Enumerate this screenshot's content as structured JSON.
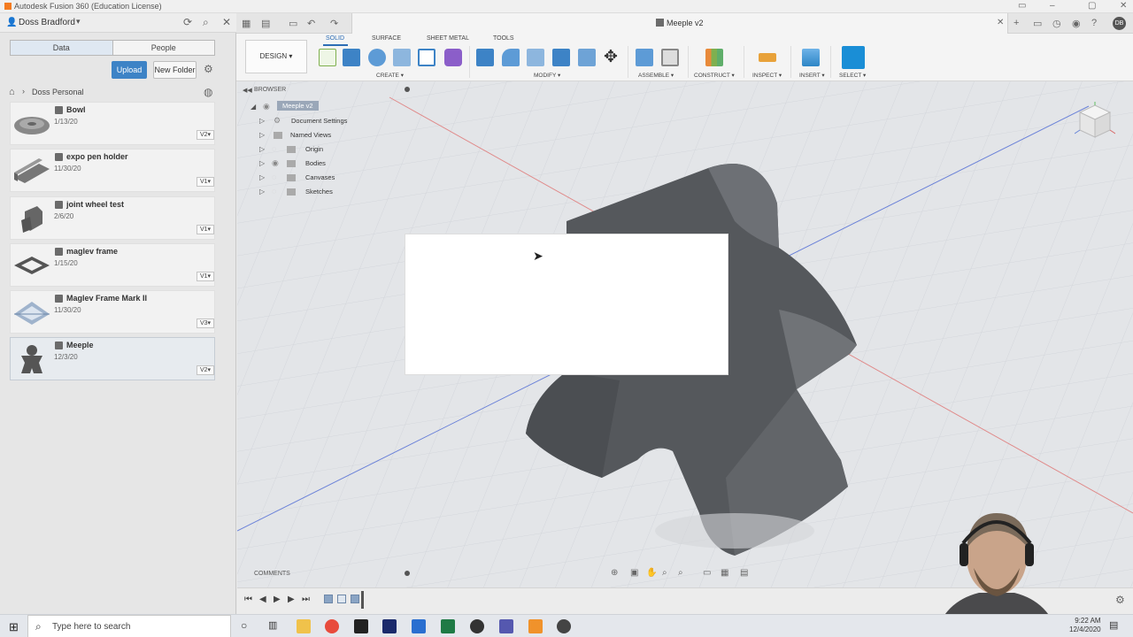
{
  "window": {
    "title": "Autodesk Fusion 360 (Education License)"
  },
  "data_panel": {
    "user_name": "Doss Bradford",
    "tabs": [
      "Data",
      "People"
    ],
    "upload_label": "Upload",
    "new_folder_label": "New Folder",
    "breadcrumb": "Doss Personal",
    "files": [
      {
        "name": "Bowl",
        "date": "1/13/20",
        "version": "V2"
      },
      {
        "name": "expo pen holder",
        "date": "11/30/20",
        "version": "V1"
      },
      {
        "name": "joint wheel test",
        "date": "2/6/20",
        "version": "V1"
      },
      {
        "name": "maglev frame",
        "date": "1/15/20",
        "version": "V1"
      },
      {
        "name": "Maglev Frame Mark II",
        "date": "11/30/20",
        "version": "V3"
      },
      {
        "name": "Meeple",
        "date": "12/3/20",
        "version": "V2"
      }
    ]
  },
  "document_tab": {
    "title": "Meeple v2"
  },
  "toolbar": {
    "workspace": "DESIGN",
    "tabs": [
      "SOLID",
      "SURFACE",
      "SHEET METAL",
      "TOOLS"
    ],
    "groups": [
      "CREATE",
      "MODIFY",
      "ASSEMBLE",
      "CONSTRUCT",
      "INSPECT",
      "INSERT",
      "SELECT"
    ]
  },
  "browser": {
    "header": "BROWSER",
    "root": "Meeple v2",
    "items": [
      "Document Settings",
      "Named Views",
      "Origin",
      "Bodies",
      "Canvases",
      "Sketches"
    ]
  },
  "comments": {
    "label": "COMMENTS"
  },
  "taskbar": {
    "search_placeholder": "Type here to search",
    "time": "9:22 AM",
    "date": "12/4/2020"
  },
  "colors": {
    "accent": "#2d6db5",
    "upload": "#3d83c6",
    "canvas": "#e3e5e8",
    "model": "#5a5d61"
  },
  "icons": [
    "windows-icon",
    "search-icon",
    "gear-icon",
    "home-icon",
    "globe-icon",
    "refresh-icon",
    "close-icon"
  ]
}
